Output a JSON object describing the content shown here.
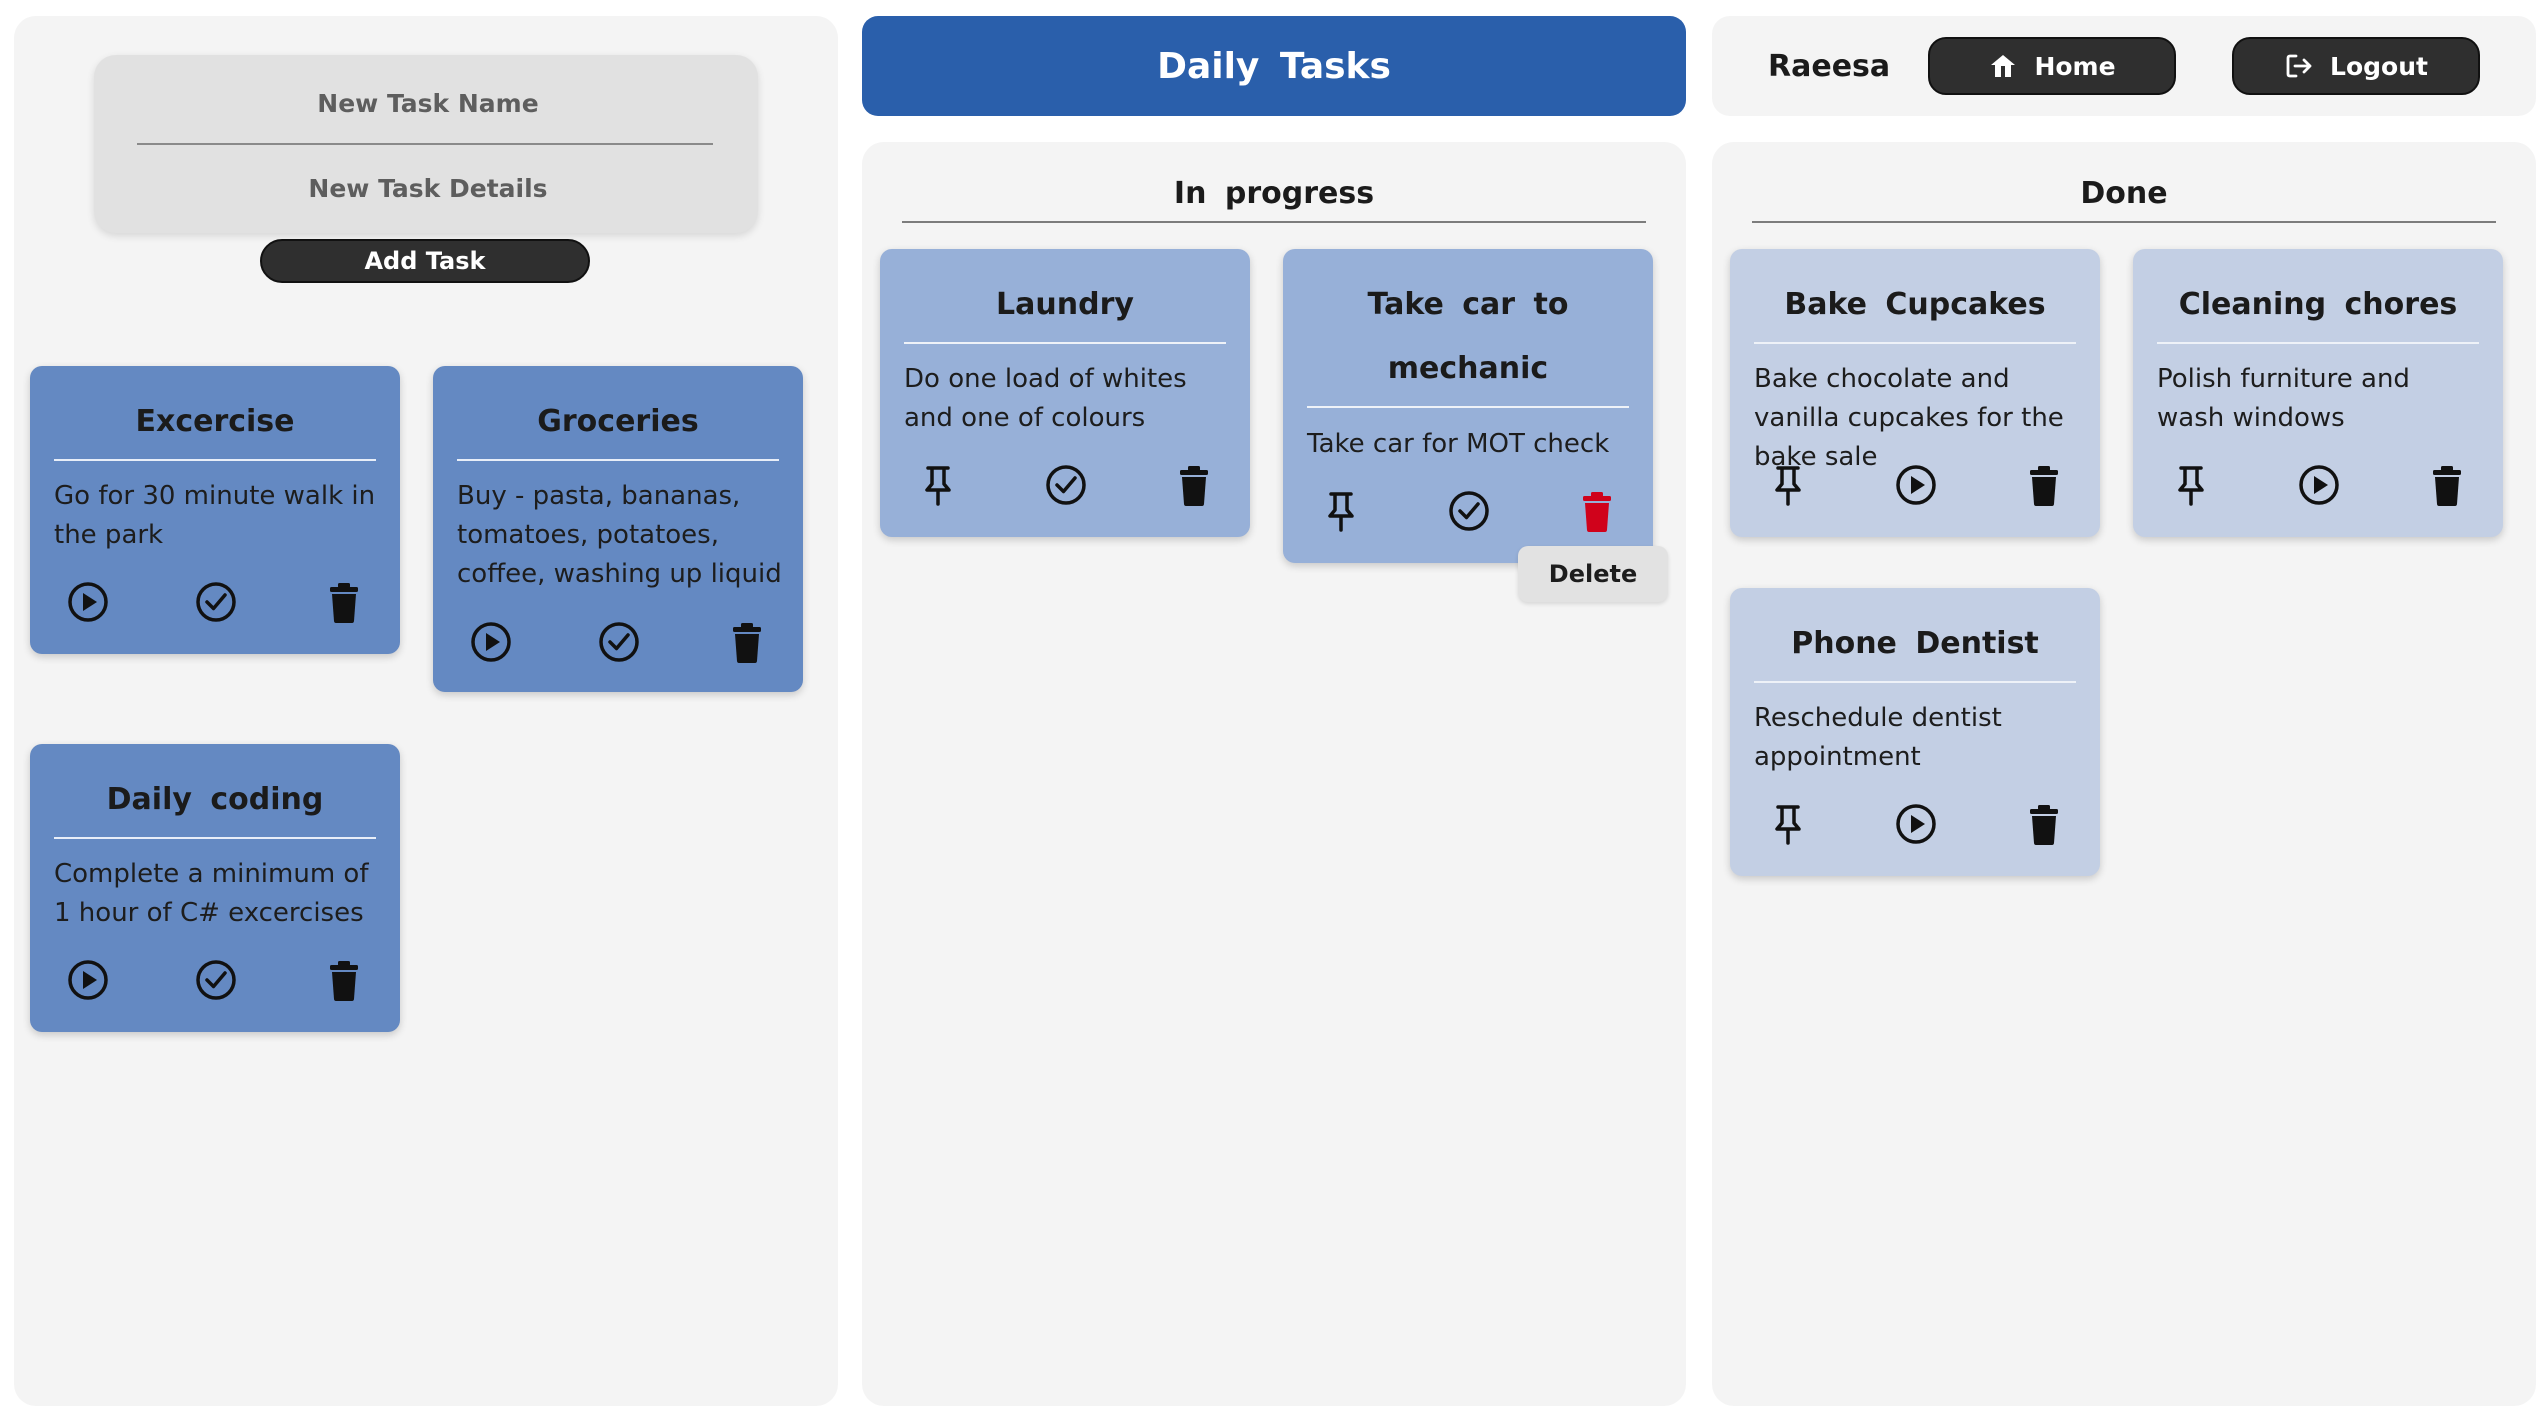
{
  "form": {
    "name_placeholder": "New Task Name",
    "details_placeholder": "New Task Details",
    "add_label": "Add Task"
  },
  "header": {
    "title": "Daily Tasks",
    "accent": "#2a5fab"
  },
  "user": {
    "name": "Raeesa",
    "home_label": "Home",
    "logout_label": "Logout"
  },
  "columns": {
    "in_progress": {
      "title": "In progress"
    },
    "done": {
      "title": "Done"
    }
  },
  "todo_tasks": [
    {
      "title": "Excercise",
      "details": "Go for 30 minute walk in the park"
    },
    {
      "title": "Groceries",
      "details": "Buy - pasta, bananas, tomatoes, potatoes, coffee, washing up liquid"
    },
    {
      "title": "Daily coding",
      "details": "Complete a minimum of 1 hour of C# excercises"
    }
  ],
  "in_progress_tasks": [
    {
      "title": "Laundry",
      "details": "Do one load of whites and one of colours"
    },
    {
      "title": "Take car to mechanic",
      "details": "Take car for MOT check"
    }
  ],
  "done_tasks": [
    {
      "title": "Bake Cupcakes",
      "details": "Bake chocolate and vanilla cupcakes for the bake sale"
    },
    {
      "title": "Cleaning chores",
      "details": "Polish furniture and wash windows"
    },
    {
      "title": "Phone Dentist",
      "details": "Reschedule dentist appointment"
    }
  ],
  "tooltip": {
    "text": "Delete"
  },
  "colors": {
    "todo_card": "#6489c2",
    "progress_card": "#97b0d8",
    "done_card": "#c3cfe4",
    "delete_hover": "#d0021b"
  }
}
